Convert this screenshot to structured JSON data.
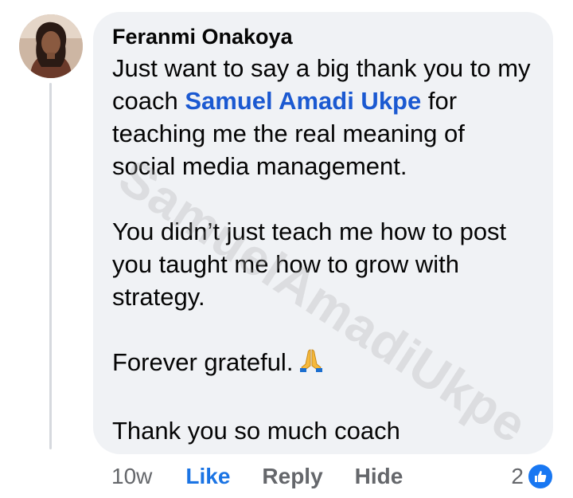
{
  "comment": {
    "author": "Feranmi Onakoya",
    "avatar_icon": "profile-photo",
    "line1_prefix": "Just want to say a big thank you to my coach ",
    "mention": "Samuel Amadi Ukpe",
    "line1_suffix": " for teaching me the real meaning of social media management.",
    "paragraph2": "You didn’t just teach me how to post you taught me how to grow with strategy.",
    "paragraph3": "Forever grateful.",
    "paragraph3_emoji": "folded-hands-icon",
    "paragraph4": "Thank you so much coach",
    "watermark": "SamuelAmadiUkpe"
  },
  "actions": {
    "time": "10w",
    "like": "Like",
    "reply": "Reply",
    "hide": "Hide"
  },
  "reactions": {
    "count": "2",
    "icon": "like-icon"
  },
  "colors": {
    "bubble": "#f0f2f5",
    "mention": "#1b59d1",
    "like_active": "#1b74e4",
    "secondary": "#65676b",
    "reaction_blue": "#1877f2"
  }
}
